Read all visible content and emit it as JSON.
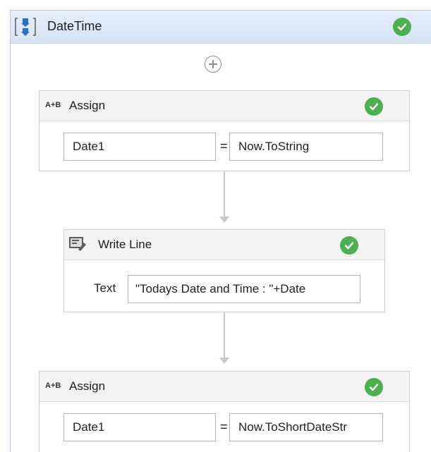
{
  "sequence": {
    "title": "DateTime",
    "icon": "sequence-icon",
    "status": "valid"
  },
  "activities": [
    {
      "type": "Assign",
      "title": "Assign",
      "icon": "assign-icon",
      "icon_text": "A+B",
      "to": "Date1",
      "operator": "=",
      "value": "Now.ToString",
      "status": "valid"
    },
    {
      "type": "WriteLine",
      "title": "Write Line",
      "icon": "write-line-icon",
      "text_label": "Text",
      "text_value": "\"Todays Date and Time : \"+Date",
      "status": "valid"
    },
    {
      "type": "Assign",
      "title": "Assign",
      "icon": "assign-icon",
      "icon_text": "A+B",
      "to": "Date1",
      "operator": "=",
      "value": "Now.ToShortDateStr",
      "status": "valid"
    }
  ],
  "colors": {
    "header_bg": "#d9e8f7",
    "check_green": "#4caf50",
    "connector": "#c8c8c8"
  }
}
